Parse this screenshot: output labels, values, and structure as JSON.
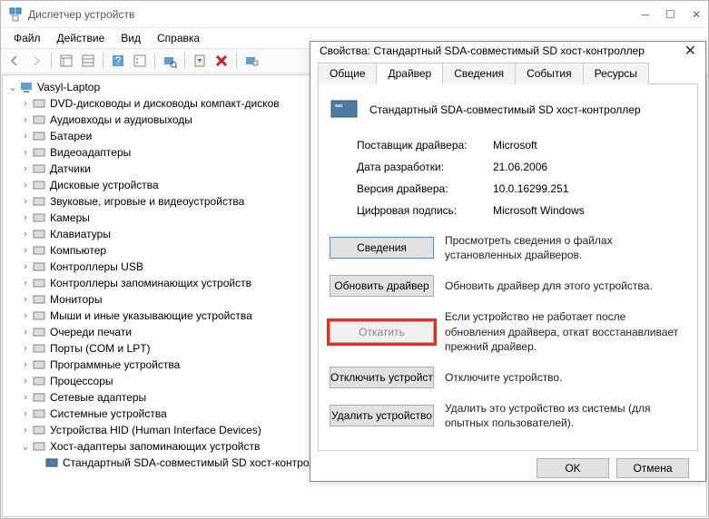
{
  "window": {
    "title": "Диспетчер устройств",
    "menu": {
      "file": "Файл",
      "action": "Действие",
      "view": "Вид",
      "help": "Справка"
    }
  },
  "tree": {
    "root": "Vasyl-Laptop",
    "items": [
      "DVD-дисководы и дисководы компакт-дисков",
      "Аудиовходы и аудиовыходы",
      "Батареи",
      "Видеоадаптеры",
      "Датчики",
      "Дисковые устройства",
      "Звуковые, игровые и видеоустройства",
      "Камеры",
      "Клавиатуры",
      "Компьютер",
      "Контроллеры USB",
      "Контроллеры запоминающих устройств",
      "Мониторы",
      "Мыши и иные указывающие устройства",
      "Очереди печати",
      "Порты (COM и LPT)",
      "Программные устройства",
      "Процессоры",
      "Сетевые адаптеры",
      "Системные устройства",
      "Устройства HID (Human Interface Devices)",
      "Хост-адаптеры запоминающих устройств"
    ],
    "child": "Стандартный SDA-совместимый SD хост-контроллер"
  },
  "dialog": {
    "title": "Свойства: Стандартный SDA-совместимый SD хост-контроллер",
    "tabs": {
      "general": "Общие",
      "driver": "Драйвер",
      "details": "Сведения",
      "events": "События",
      "resources": "Ресурсы"
    },
    "device_name": "Стандартный SDA-совместимый SD хост-контроллер",
    "rows": {
      "provider_label": "Поставщик драйвера:",
      "provider_value": "Microsoft",
      "date_label": "Дата разработки:",
      "date_value": "21.06.2006",
      "version_label": "Версия драйвера:",
      "version_value": "10.0.16299.251",
      "digsig_label": "Цифровая подпись:",
      "digsig_value": "Microsoft Windows"
    },
    "buttons": {
      "details": {
        "label": "Сведения",
        "desc": "Просмотреть сведения о файлах установленных драйверов."
      },
      "update": {
        "label": "Обновить драйвер",
        "desc": "Обновить драйвер для этого устройства."
      },
      "rollback": {
        "label": "Откатить",
        "desc": "Если устройство не работает после обновления драйвера, откат восстанавливает прежний драйвер."
      },
      "disable": {
        "label": "Отключить устройство",
        "desc": "Отключите устройство."
      },
      "remove": {
        "label": "Удалить устройство",
        "desc": "Удалить это устройство из системы (для опытных пользователей)."
      }
    },
    "footer": {
      "ok": "OK",
      "cancel": "Отмена"
    }
  }
}
